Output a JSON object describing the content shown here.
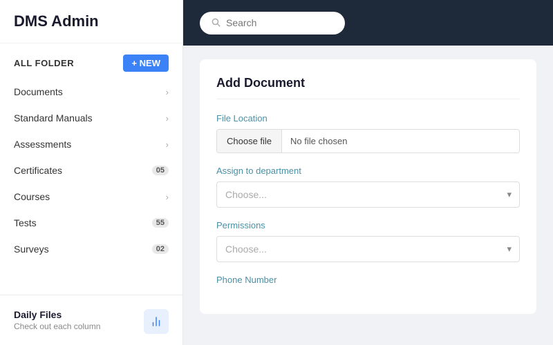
{
  "sidebar": {
    "logo": "DMS Admin",
    "folder_header": "ALL FOLDER",
    "new_button": "+ NEW",
    "nav_items": [
      {
        "label": "Documents",
        "has_chevron": true,
        "badge": null
      },
      {
        "label": "Standard Manuals",
        "has_chevron": true,
        "badge": null
      },
      {
        "label": "Assessments",
        "has_chevron": true,
        "badge": null
      },
      {
        "label": "Certificates",
        "has_chevron": false,
        "badge": "05"
      },
      {
        "label": "Courses",
        "has_chevron": true,
        "badge": null
      },
      {
        "label": "Tests",
        "has_chevron": false,
        "badge": "55"
      },
      {
        "label": "Surveys",
        "has_chevron": false,
        "badge": "02"
      }
    ],
    "daily_files": {
      "title": "Daily Files",
      "subtitle": "Check out each column"
    }
  },
  "header": {
    "search_placeholder": "Search"
  },
  "main": {
    "card_title": "Add Document",
    "file_location_label": "File Location",
    "choose_file_btn": "Choose file",
    "no_file_chosen": "No file chosen",
    "assign_dept_label": "Assign to department",
    "assign_dept_placeholder": "Choose...",
    "permissions_label": "Permissions",
    "permissions_placeholder": "Choose...",
    "phone_number_label": "Phone Number"
  }
}
